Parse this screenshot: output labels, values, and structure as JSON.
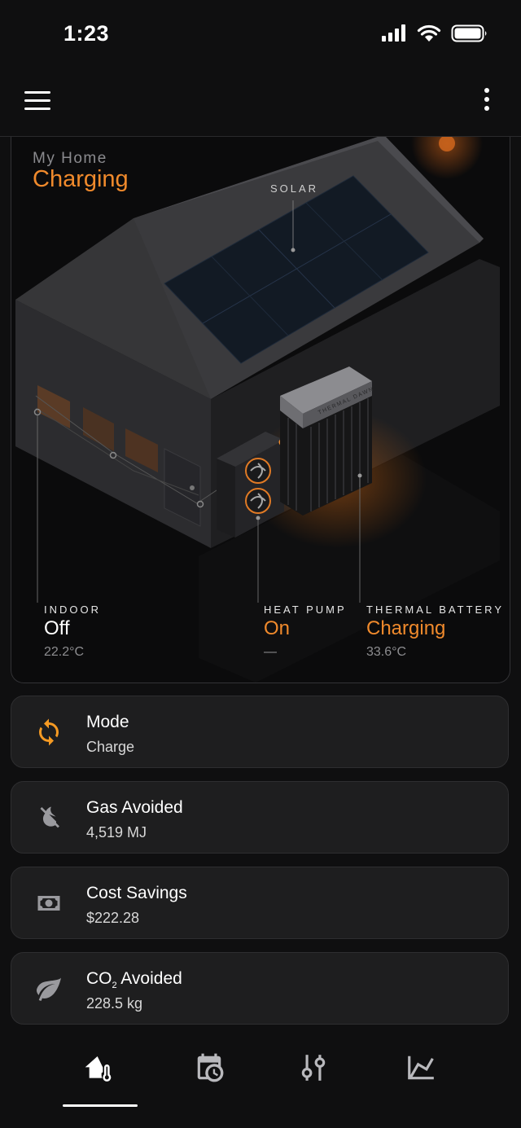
{
  "status_bar": {
    "time": "1:23"
  },
  "home": {
    "name": "My Home",
    "state": "Charging",
    "solar_label": "SOLAR",
    "devices": {
      "indoor": {
        "label": "INDOOR",
        "state": "Off",
        "sub": "22.2°C"
      },
      "heat_pump": {
        "label": "HEAT PUMP",
        "state": "On",
        "sub": "—"
      },
      "thermal_battery": {
        "label": "THERMAL BATTERY",
        "state": "Charging",
        "sub": "33.6°C",
        "brand": "THERMAL DAWN"
      }
    }
  },
  "cards": {
    "mode": {
      "title": "Mode",
      "value": "Charge",
      "icon": "sync-icon"
    },
    "gas": {
      "title": "Gas Avoided",
      "value": "4,519 MJ",
      "icon": "gas-off-icon"
    },
    "cost": {
      "title": "Cost Savings",
      "value": "$222.28",
      "icon": "cash-icon"
    },
    "co2": {
      "title_main": "CO",
      "title_sub": "2",
      "title_rest": " Avoided",
      "value": "228.5 kg",
      "icon": "leaf-icon"
    }
  },
  "nav": {
    "items": [
      "home-thermometer-icon",
      "calendar-clock-icon",
      "tune-icon",
      "chart-line-icon"
    ],
    "active_index": 0
  },
  "colors": {
    "accent": "#f08a2c",
    "background": "#0f0f10",
    "card": "#1e1e1f"
  }
}
